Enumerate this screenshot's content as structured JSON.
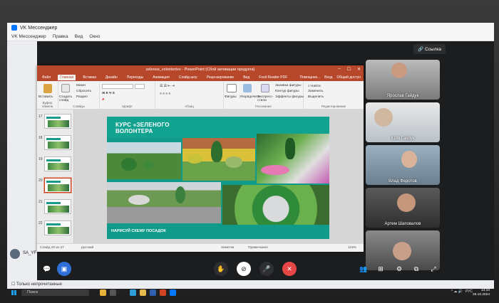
{
  "vk": {
    "window_title": "VK Мессенджер",
    "menu": [
      "VK Мессенджер",
      "Правка",
      "Вид",
      "Окно"
    ],
    "link_button": "Ссылка",
    "chats": [
      "SA_YF",
      "Только непрочитанные"
    ]
  },
  "ppt": {
    "title": "zelenoe_volontertvo - PowerPoint (Сбой активации продукта)",
    "tabs": [
      "Файл",
      "Главная",
      "Вставка",
      "Дизайн",
      "Переходы",
      "Анимация",
      "Слайд-шоу",
      "Рецензирование",
      "Вид",
      "Foxit Reader PDF"
    ],
    "tabs_right": [
      "Помощник...",
      "Вход",
      "Общий доступ"
    ],
    "ribbon": {
      "paste": "Вставить",
      "create_slide": "Создать слайд",
      "layout": "Макет",
      "reset": "Сбросить",
      "section": "Раздел",
      "shapes": "Фигуры",
      "arrange": "Упорядочить",
      "express_styles": "Экспресс-стили",
      "fill": "Заливка фигуры",
      "outline": "Контур фигуры",
      "effects": "Эффекты фигуры",
      "find": "Найти",
      "replace": "Заменить",
      "select": "Выделить",
      "groups": [
        "Буфер обмена",
        "Слайды",
        "Шрифт",
        "Абзац",
        "Рисование",
        "Редактирование"
      ]
    },
    "thumbnails": [
      "17",
      "18",
      "19",
      "20",
      "21",
      "22"
    ],
    "selected_thumb": "20",
    "slide": {
      "title_line1": "КУРС «ЗЕЛЕНОГО",
      "title_line2": "ВОЛОНТЕРА",
      "footer": "НАРИСУЙ СХЕМУ ПОСАДОК"
    },
    "status": {
      "slide_info": "Слайд 20 из 27",
      "language": "русский",
      "notes": "Заметки",
      "comments": "Примечания",
      "zoom": "116%"
    }
  },
  "participants": [
    "Ярослав Гайдук",
    "Юля Гайдук",
    "Влад Федотов",
    "Артем Шаповалов",
    ""
  ],
  "taskbar": {
    "search_placeholder": "Поиск",
    "lang": "РУС",
    "time": "14:10",
    "date": "28.10.2024"
  },
  "colors": {
    "ppt_accent": "#b7472a",
    "slide_teal": "#0f9a8a",
    "end_call": "#e64646"
  }
}
